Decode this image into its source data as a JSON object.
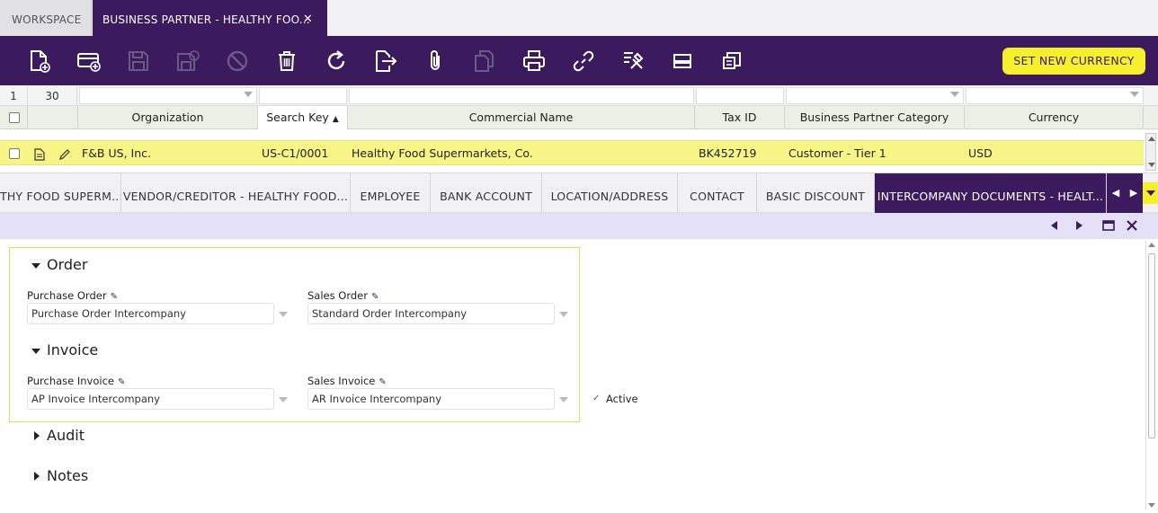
{
  "top_tabs": {
    "workspace": "WORKSPACE",
    "active": "BUSINESS PARTNER - HEALTHY FOO...",
    "close": "✕"
  },
  "toolbar": {
    "set_currency": "SET NEW CURRENCY",
    "icons": [
      "new-document-icon",
      "new-row-icon",
      "save-icon",
      "save-close-icon",
      "undo-icon",
      "delete-icon",
      "refresh-icon",
      "export-icon",
      "attachment-icon",
      "copy-icon",
      "print-icon",
      "link-icon",
      "tools-icon",
      "layout-icon",
      "translate-icon"
    ]
  },
  "grid": {
    "row_number": "1",
    "total_count": "30",
    "columns": [
      "Organization",
      "Search Key",
      "Commercial Name",
      "Tax ID",
      "Business Partner Category",
      "Currency"
    ],
    "sort_arrow": "▲",
    "row": {
      "organization": "F&B US, Inc.",
      "search_key": "US-C1/0001",
      "commercial_name": "Healthy Food Supermarkets, Co.",
      "tax_id": "BK452719",
      "category": "Customer - Tier 1",
      "currency": "USD"
    }
  },
  "subtabs": [
    "THY FOOD SUPERM...",
    "VENDOR/CREDITOR - HEALTHY FOOD...",
    "EMPLOYEE",
    "BANK ACCOUNT",
    "LOCATION/ADDRESS",
    "CONTACT",
    "BASIC DISCOUNT",
    "INTERCOMPANY DOCUMENTS - HEALT..."
  ],
  "form": {
    "section_order": "Order",
    "section_invoice": "Invoice",
    "section_audit": "Audit",
    "section_notes": "Notes",
    "purchase_order_label": "Purchase Order",
    "purchase_order_value": "Purchase Order Intercompany",
    "sales_order_label": "Sales Order",
    "sales_order_value": "Standard Order Intercompany",
    "purchase_invoice_label": "Purchase Invoice",
    "purchase_invoice_value": "AP Invoice Intercompany",
    "sales_invoice_label": "Sales Invoice",
    "sales_invoice_value": "AR Invoice Intercompany",
    "active_label": "Active",
    "active_check": "✓"
  },
  "colors": {
    "brand": "#3b1a5e",
    "accent": "#f6ef2c",
    "selected_row": "#f8f587"
  }
}
